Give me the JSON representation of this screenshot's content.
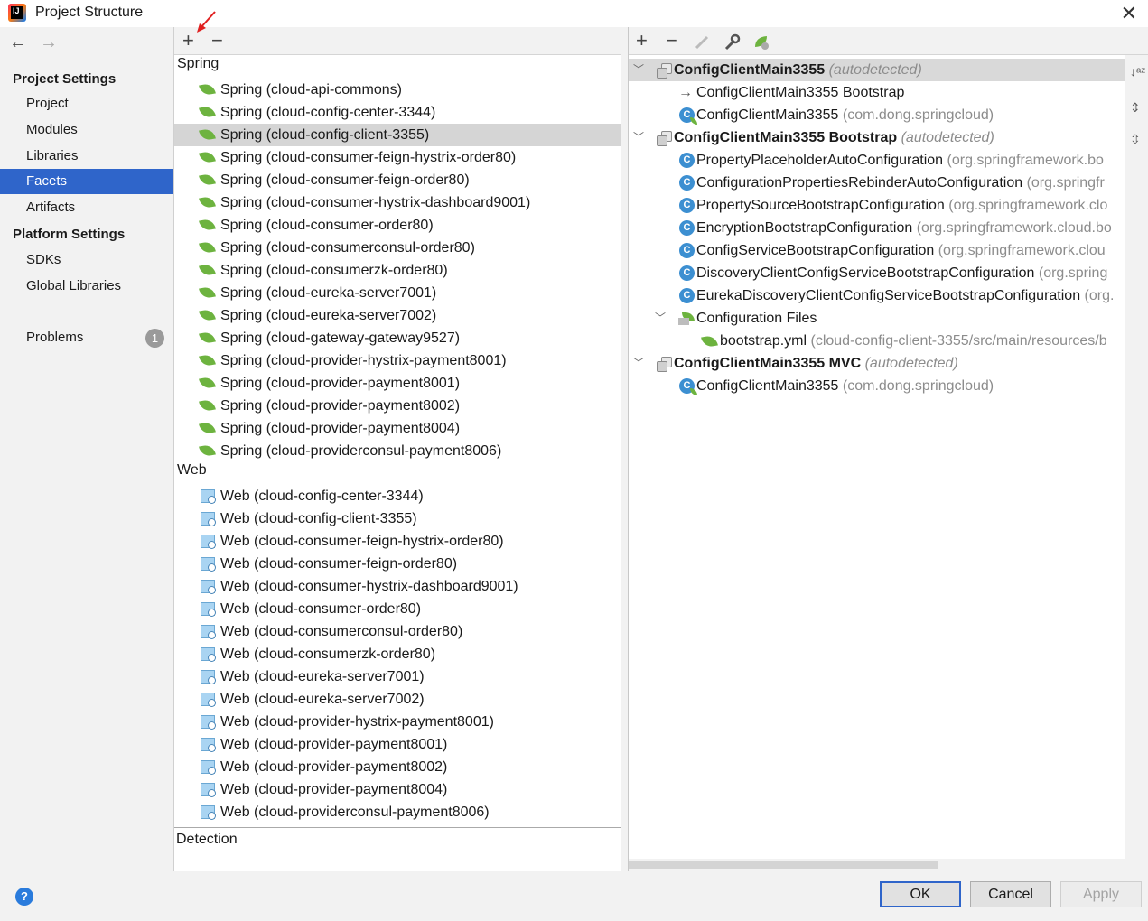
{
  "window": {
    "title": "Project Structure"
  },
  "nav": {
    "back": "←",
    "forward": "→",
    "project_settings": "Project Settings",
    "project_items": [
      "Project",
      "Modules",
      "Libraries",
      "Facets",
      "Artifacts"
    ],
    "platform_settings": "Platform Settings",
    "platform_items": [
      "SDKs",
      "Global Libraries"
    ],
    "problems": "Problems",
    "problems_count": "1"
  },
  "mid": {
    "add": "+",
    "remove": "−",
    "spring_group": "Spring",
    "spring_items": [
      "Spring (cloud-api-commons)",
      "Spring (cloud-config-center-3344)",
      "Spring (cloud-config-client-3355)",
      "Spring (cloud-consumer-feign-hystrix-order80)",
      "Spring (cloud-consumer-feign-order80)",
      "Spring (cloud-consumer-hystrix-dashboard9001)",
      "Spring (cloud-consumer-order80)",
      "Spring (cloud-consumerconsul-order80)",
      "Spring (cloud-consumerzk-order80)",
      "Spring (cloud-eureka-server7001)",
      "Spring (cloud-eureka-server7002)",
      "Spring (cloud-gateway-gateway9527)",
      "Spring (cloud-provider-hystrix-payment8001)",
      "Spring (cloud-provider-payment8001)",
      "Spring (cloud-provider-payment8002)",
      "Spring (cloud-provider-payment8004)",
      "Spring (cloud-providerconsul-payment8006)"
    ],
    "web_group": "Web",
    "web_items": [
      "Web (cloud-config-center-3344)",
      "Web (cloud-config-client-3355)",
      "Web (cloud-consumer-feign-hystrix-order80)",
      "Web (cloud-consumer-feign-order80)",
      "Web (cloud-consumer-hystrix-dashboard9001)",
      "Web (cloud-consumer-order80)",
      "Web (cloud-consumerconsul-order80)",
      "Web (cloud-consumerzk-order80)",
      "Web (cloud-eureka-server7001)",
      "Web (cloud-eureka-server7002)",
      "Web (cloud-provider-hystrix-payment8001)",
      "Web (cloud-provider-payment8001)",
      "Web (cloud-provider-payment8002)",
      "Web (cloud-provider-payment8004)",
      "Web (cloud-providerconsul-payment8006)"
    ],
    "detection": "Detection"
  },
  "right": {
    "toolbar": {
      "add": "+",
      "remove": "−"
    },
    "autodetected": "(autodetected)",
    "ctx1": {
      "name": "ConfigClientMain3355"
    },
    "ctx1_link": "ConfigClientMain3355 Bootstrap",
    "ctx1_class": {
      "name": "ConfigClientMain3355",
      "pkg": "(com.dong.springcloud)"
    },
    "ctx2": {
      "name": "ConfigClientMain3355 Bootstrap"
    },
    "ctx2_classes": [
      {
        "name": "PropertyPlaceholderAutoConfiguration",
        "pkg": "(org.springframework.bo"
      },
      {
        "name": "ConfigurationPropertiesRebinderAutoConfiguration",
        "pkg": "(org.springfr"
      },
      {
        "name": "PropertySourceBootstrapConfiguration",
        "pkg": "(org.springframework.clo"
      },
      {
        "name": "EncryptionBootstrapConfiguration",
        "pkg": "(org.springframework.cloud.bo"
      },
      {
        "name": "ConfigServiceBootstrapConfiguration",
        "pkg": "(org.springframework.clou"
      },
      {
        "name": "DiscoveryClientConfigServiceBootstrapConfiguration",
        "pkg": "(org.spring"
      },
      {
        "name": "EurekaDiscoveryClientConfigServiceBootstrapConfiguration",
        "pkg": "(org."
      }
    ],
    "config_files": "Configuration Files",
    "bootstrap_file": {
      "name": "bootstrap.yml",
      "path": "(cloud-config-client-3355/src/main/resources/b"
    },
    "ctx3": {
      "name": "ConfigClientMain3355 MVC"
    },
    "ctx3_class": {
      "name": "ConfigClientMain3355",
      "pkg": "(com.dong.springcloud)"
    }
  },
  "footer": {
    "help": "?",
    "ok": "OK",
    "cancel": "Cancel",
    "apply": "Apply"
  },
  "colors": {
    "selection": "#2f65ca",
    "spring_green": "#6db33f",
    "annotation_red": "#e02020"
  }
}
